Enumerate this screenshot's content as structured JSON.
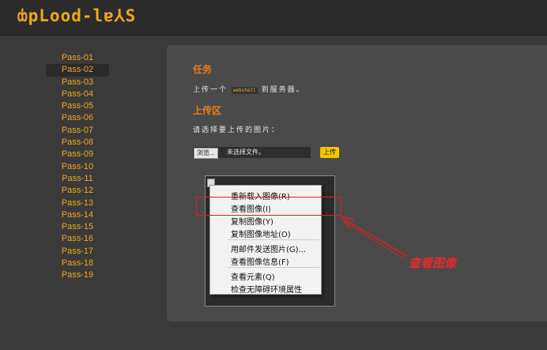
{
  "header": {
    "logo_text": "ȸpLood-lɐ⅄S"
  },
  "sidebar": {
    "items": [
      "Pass-01",
      "Pass-02",
      "Pass-03",
      "Pass-04",
      "Pass-05",
      "Pass-06",
      "Pass-07",
      "Pass-08",
      "Pass-09",
      "Pass-10",
      "Pass-11",
      "Pass-12",
      "Pass-13",
      "Pass-14",
      "Pass-15",
      "Pass-16",
      "Pass-17",
      "Pass-18",
      "Pass-19"
    ],
    "active_index": 1
  },
  "panel": {
    "task_heading": "任务",
    "task_text_prefix": "上传一个",
    "task_code": "webshell",
    "task_text_suffix": "到服务器。",
    "upload_heading": "上传区",
    "prompt": "请选择要上传的图片：",
    "browse_label": "浏览...",
    "file_status": "未选择文件。",
    "upload_label": "上传"
  },
  "context_menu": {
    "items": [
      {
        "label": "重新载入图像(R)"
      },
      {
        "label": "查看图像(I)"
      },
      {
        "label": "复制图像(Y)"
      },
      {
        "label": "复制图像地址(O)"
      },
      {
        "label": "用邮件发送图片(G)..."
      },
      {
        "label": "查看图像信息(F)"
      },
      {
        "label": "查看元素(Q)"
      },
      {
        "label": "检查无障碍环境属性"
      }
    ]
  },
  "annotation": {
    "text": "查看图像",
    "color": "#e42a2a"
  },
  "colors": {
    "accent": "#f0a81c",
    "heading": "#f07a16",
    "upload_button": "#f5c500"
  }
}
